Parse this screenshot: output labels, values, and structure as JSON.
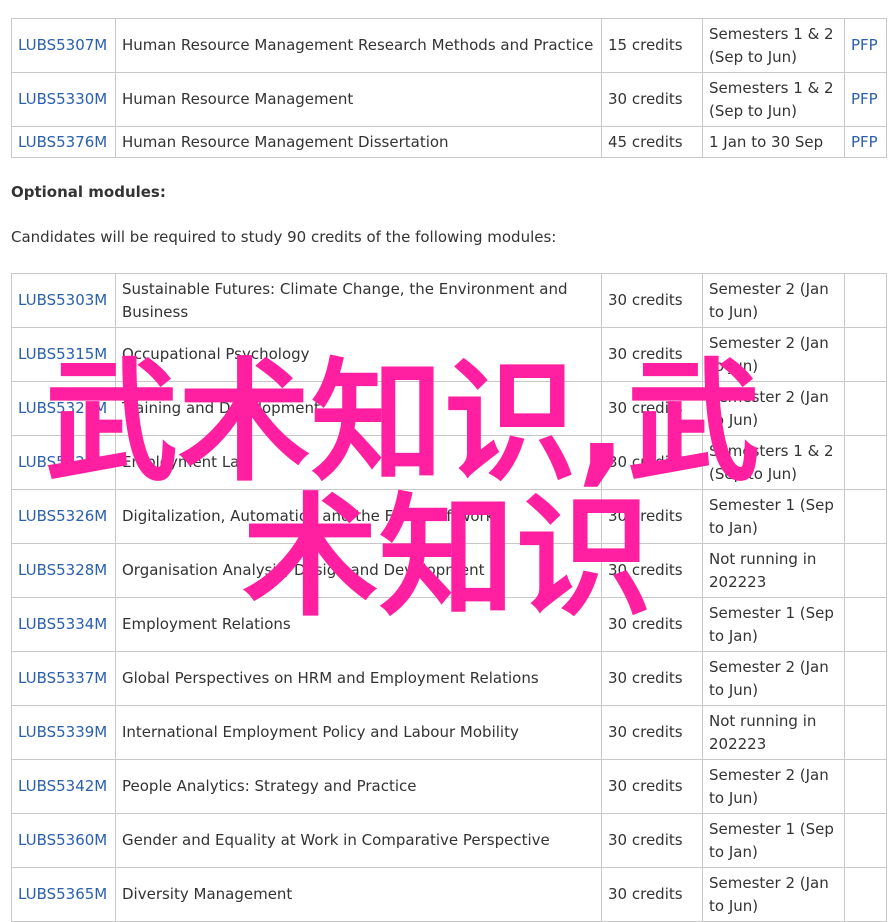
{
  "compulsory_modules": [
    {
      "code": "LUBS5307M",
      "title": "Human Resource Management Research Methods and Practice",
      "credits": "15 credits",
      "semester": "Semesters 1 & 2 (Sep to Jun)",
      "pfp": "PFP"
    },
    {
      "code": "LUBS5330M",
      "title": "Human Resource Management",
      "credits": "30 credits",
      "semester": "Semesters 1 & 2 (Sep to Jun)",
      "pfp": "PFP"
    },
    {
      "code": "LUBS5376M",
      "title": "Human Resource Management Dissertation",
      "credits": "45 credits",
      "semester": "1 Jan to 30 Sep",
      "pfp": "PFP"
    }
  ],
  "optional": {
    "heading": "Optional modules:",
    "intro": "Candidates will be required to study 90 credits of the following modules:",
    "modules": [
      {
        "code": "LUBS5303M",
        "title": "Sustainable Futures: Climate Change, the Environment and Business",
        "credits": "30 credits",
        "semester": "Semester 2 (Jan to Jun)"
      },
      {
        "code": "LUBS5315M",
        "title": "Occupational Psychology",
        "credits": "30 credits",
        "semester": "Semester 2 (Jan to Jun)"
      },
      {
        "code": "LUBS5322M",
        "title": "Training and Development",
        "credits": "30 credits",
        "semester": "Semester 2 (Jan to Jun)"
      },
      {
        "code": "LUBS5325M",
        "title": "Employment Law",
        "credits": "30 credits",
        "semester": "Semesters 1 & 2 (Sep to Jun)"
      },
      {
        "code": "LUBS5326M",
        "title": "Digitalization, Automation and the Future of Work",
        "credits": "30 credits",
        "semester": "Semester 1 (Sep to Jan)"
      },
      {
        "code": "LUBS5328M",
        "title": "Organisation Analysis, Design and Development",
        "credits": "30 credits",
        "semester": "Not running in 202223"
      },
      {
        "code": "LUBS5334M",
        "title": "Employment Relations",
        "credits": "30 credits",
        "semester": "Semester 1 (Sep to Jan)"
      },
      {
        "code": "LUBS5337M",
        "title": "Global Perspectives on HRM and Employment Relations",
        "credits": "30 credits",
        "semester": "Semester 2 (Jan to Jun)"
      },
      {
        "code": "LUBS5339M",
        "title": "International Employment Policy and Labour Mobility",
        "credits": "30 credits",
        "semester": "Not running in 202223"
      },
      {
        "code": "LUBS5342M",
        "title": "People Analytics: Strategy and Practice",
        "credits": "30 credits",
        "semester": "Semester 2 (Jan to Jun)"
      },
      {
        "code": "LUBS5360M",
        "title": "Gender and Equality at Work in Comparative Perspective",
        "credits": "30 credits",
        "semester": "Semester 1 (Sep to Jan)"
      },
      {
        "code": "LUBS5365M",
        "title": "Diversity Management",
        "credits": "30 credits",
        "semester": "Semester 2 (Jan to Jun)"
      }
    ]
  },
  "watermark": {
    "line1": "武术知识,武",
    "line2": "术知识",
    "color": "#ff1fa0"
  },
  "colors": {
    "link": "#2a5fae",
    "text": "#333333",
    "border": "#c8c8c8"
  }
}
